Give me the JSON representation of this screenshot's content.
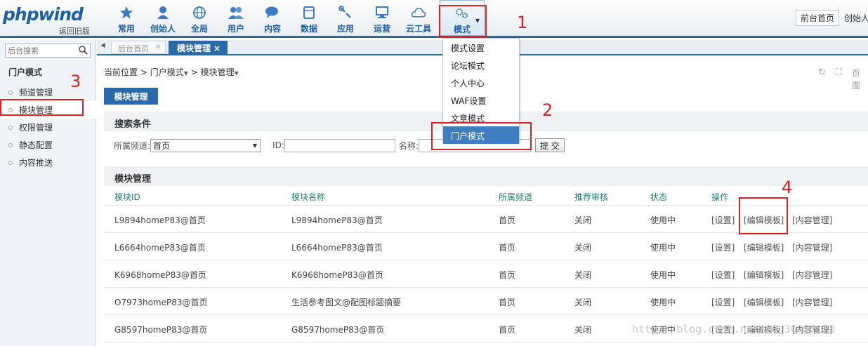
{
  "header": {
    "logo": "phpwind",
    "logo_sub": "返回旧版",
    "nav": [
      {
        "label": "常用",
        "icon": "star-icon"
      },
      {
        "label": "创始人",
        "icon": "person-icon"
      },
      {
        "label": "全局",
        "icon": "globe-icon"
      },
      {
        "label": "用户",
        "icon": "users-icon"
      },
      {
        "label": "内容",
        "icon": "chat-bubble-icon"
      },
      {
        "label": "数据",
        "icon": "database-icon"
      },
      {
        "label": "应用",
        "icon": "wrench-icon"
      },
      {
        "label": "运营",
        "icon": "monitor-icon"
      },
      {
        "label": "云工具",
        "icon": "cloud-icon"
      }
    ],
    "mode_label": "模式",
    "frontpage_button": "前台首页",
    "user": "创始人"
  },
  "dropdown": {
    "items": [
      "模式设置",
      "论坛模式",
      "个人中心",
      "WAF设置",
      "文章模式",
      "门户模式"
    ],
    "highlighted": "门户模式"
  },
  "sidebar": {
    "search_placeholder": "后台搜索",
    "title": "门户模式",
    "items": [
      "频道管理",
      "模块管理",
      "权限管理",
      "静态配置",
      "内容推送"
    ],
    "active": "模块管理"
  },
  "tabs": [
    {
      "label": "后台首页",
      "close": "×"
    },
    {
      "label": "模块管理",
      "close": "×"
    }
  ],
  "breadcrumb": {
    "prefix": "当前位置",
    "sep": ">",
    "level1": "门户模式",
    "level2": "模块管理"
  },
  "toolbar": {
    "page_text": "页面"
  },
  "main_button": "模块管理",
  "search": {
    "title": "搜索条件",
    "channel_label": "所属频道:",
    "channel_value": "首页",
    "id_label": "ID:",
    "name_label": "名称:",
    "submit": "提 交"
  },
  "table": {
    "title": "模块管理",
    "headers": [
      "模块ID",
      "模块名称",
      "所属频道",
      "推荐审核",
      "状态",
      "操作"
    ],
    "actions": [
      "[设置]",
      "[编辑模板]",
      "[内容管理]"
    ],
    "rows": [
      [
        "L9894homeP83@首页",
        "L9894homeP83@首页",
        "首页",
        "关闭",
        "使用中"
      ],
      [
        "L6664homeP83@首页",
        "L6664homeP83@首页",
        "首页",
        "关闭",
        "使用中"
      ],
      [
        "K6968homeP83@首页",
        "K6968homeP83@首页",
        "首页",
        "关闭",
        "使用中"
      ],
      [
        "O7973homeP83@首页",
        "生活参考图文@配图标题摘要",
        "首页",
        "关闭",
        "使用中"
      ],
      [
        "G8597homeP83@首页",
        "G8597homeP83@首页",
        "首页",
        "关闭",
        "使用中"
      ]
    ]
  },
  "annotations": [
    "1",
    "2",
    "3",
    "4"
  ],
  "watermark": "http://blog.csdn.net/m0_36021128",
  "colors": {
    "accent": "#2b6aa9",
    "highlight": "#e02020",
    "header_text": "#1f7f6e"
  }
}
